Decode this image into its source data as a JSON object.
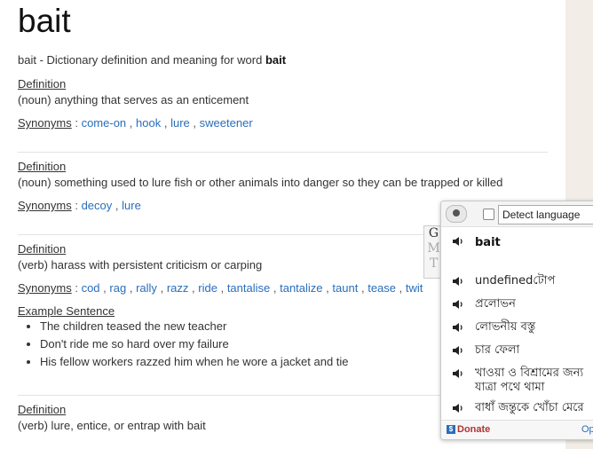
{
  "word": "bait",
  "intro": {
    "prefix": "bait - Dictionary definition and meaning for word ",
    "word": "bait"
  },
  "labels": {
    "definition": "Definition",
    "synonyms": "Synonyms",
    "example_sentence": "Example Sentence",
    "colon": ":"
  },
  "entries": [
    {
      "definition": "(noun) anything that serves as an enticement",
      "synonyms": [
        "come-on",
        "hook",
        "lure",
        "sweetener"
      ]
    },
    {
      "definition": "(noun) something used to lure fish or other animals into danger so they can be trapped or killed",
      "synonyms": [
        "decoy",
        "lure"
      ]
    },
    {
      "definition": "(verb) harass with persistent criticism or carping",
      "synonyms": [
        "cod",
        "rag",
        "rally",
        "razz",
        "ride",
        "tantalise",
        "tantalize",
        "taunt",
        "tease",
        "twit"
      ],
      "examples": [
        "The children teased the new teacher",
        "Don't ride me so hard over my failure",
        "His fellow workers razzed him when he wore a jacket and tie"
      ]
    },
    {
      "definition": "(verb) lure, entice, or entrap with bait"
    }
  ],
  "popup": {
    "detect_language": "Detect language",
    "gmt": [
      "G",
      "M",
      "T"
    ],
    "source_word": "bait",
    "translations": [
      "undefinedটোপ",
      "প্রলোভন",
      "লোভনীয় বস্তু",
      "চার ফেলা",
      "খাওয়া ও বিশ্রামের জন্য যাত্রা পথে থামা",
      "বাধাঁ জন্তুকে খোঁচা মেরে"
    ],
    "donate": "Donate",
    "options": "Op",
    "colors": {
      "link": "#2a6ebb",
      "donate": "#b23333"
    }
  }
}
